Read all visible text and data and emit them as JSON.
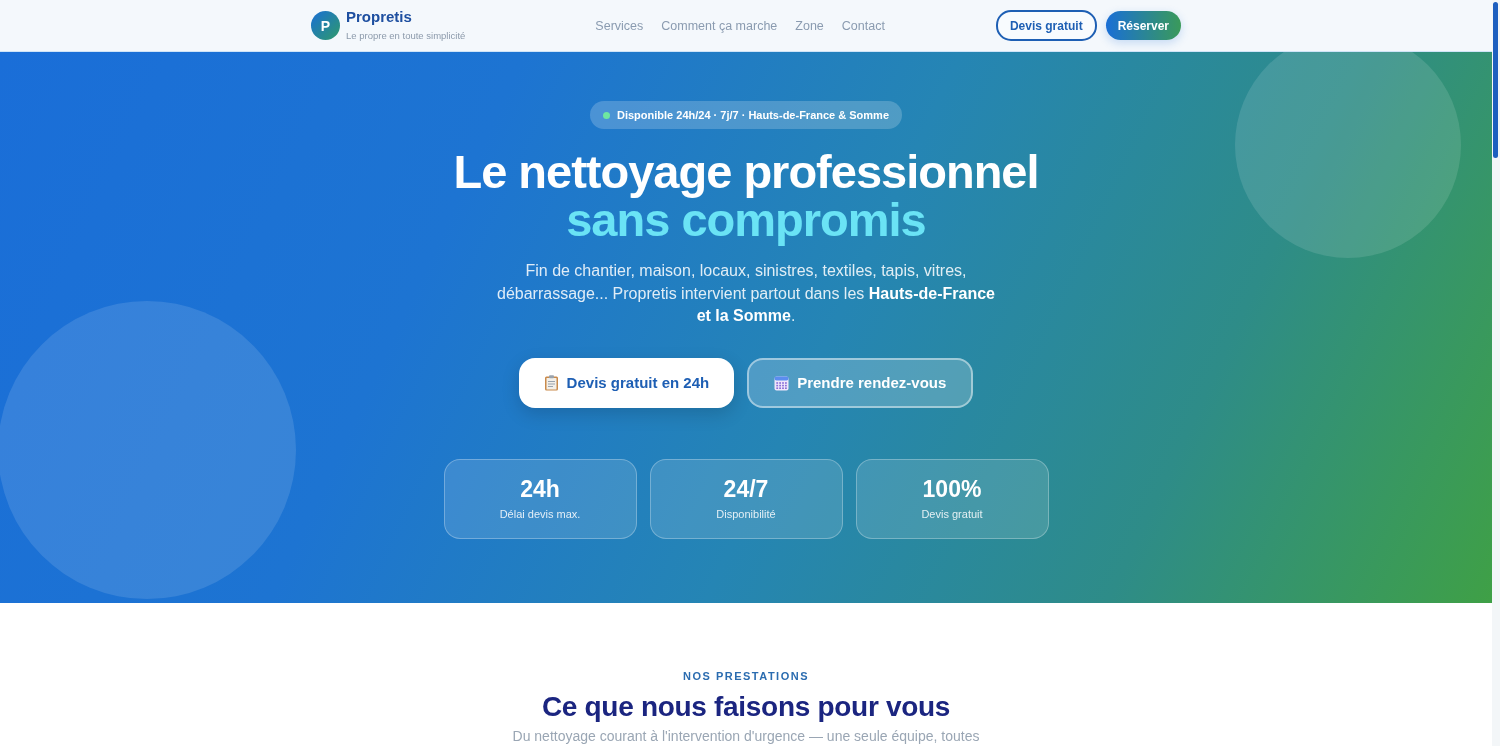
{
  "header": {
    "logo_letter": "P",
    "brand": "Propretis",
    "tagline": "Le propre en toute simplicité",
    "nav": [
      {
        "label": "Services"
      },
      {
        "label": "Comment ça marche"
      },
      {
        "label": "Zone"
      },
      {
        "label": "Contact"
      }
    ],
    "buttons": [
      {
        "label": "Devis gratuit",
        "kind": "outline"
      },
      {
        "label": "Réserver",
        "kind": "primary"
      }
    ]
  },
  "hero": {
    "badge": "Disponible 24h/24 · 7j/7 · Hauts-de-France & Somme",
    "title": "Le nettoyage professionnel",
    "title_highlight": "sans compromis",
    "description": "Fin de chantier, maison, locaux, sinistres, textiles, tapis, vitres, débarrassage... Propretis intervient partout dans les **Hauts-de-France et la Somme**.",
    "buttons": [
      {
        "label": "Devis gratuit en 24h",
        "kind": "primary"
      },
      {
        "label": "Prendre rendez-vous",
        "kind": "secondary"
      }
    ],
    "stats": [
      {
        "value": "24h",
        "label": "Délai devis max."
      },
      {
        "value": "24/7",
        "label": "Disponibilité"
      },
      {
        "value": "100%",
        "label": "Devis gratuit"
      }
    ]
  },
  "services": {
    "eyebrow": "NOS PRESTATIONS",
    "title": "Ce que nous faisons pour vous",
    "intro": "Du nettoyage courant à l'intervention d'urgence — une seule équipe, toutes"
  }
}
